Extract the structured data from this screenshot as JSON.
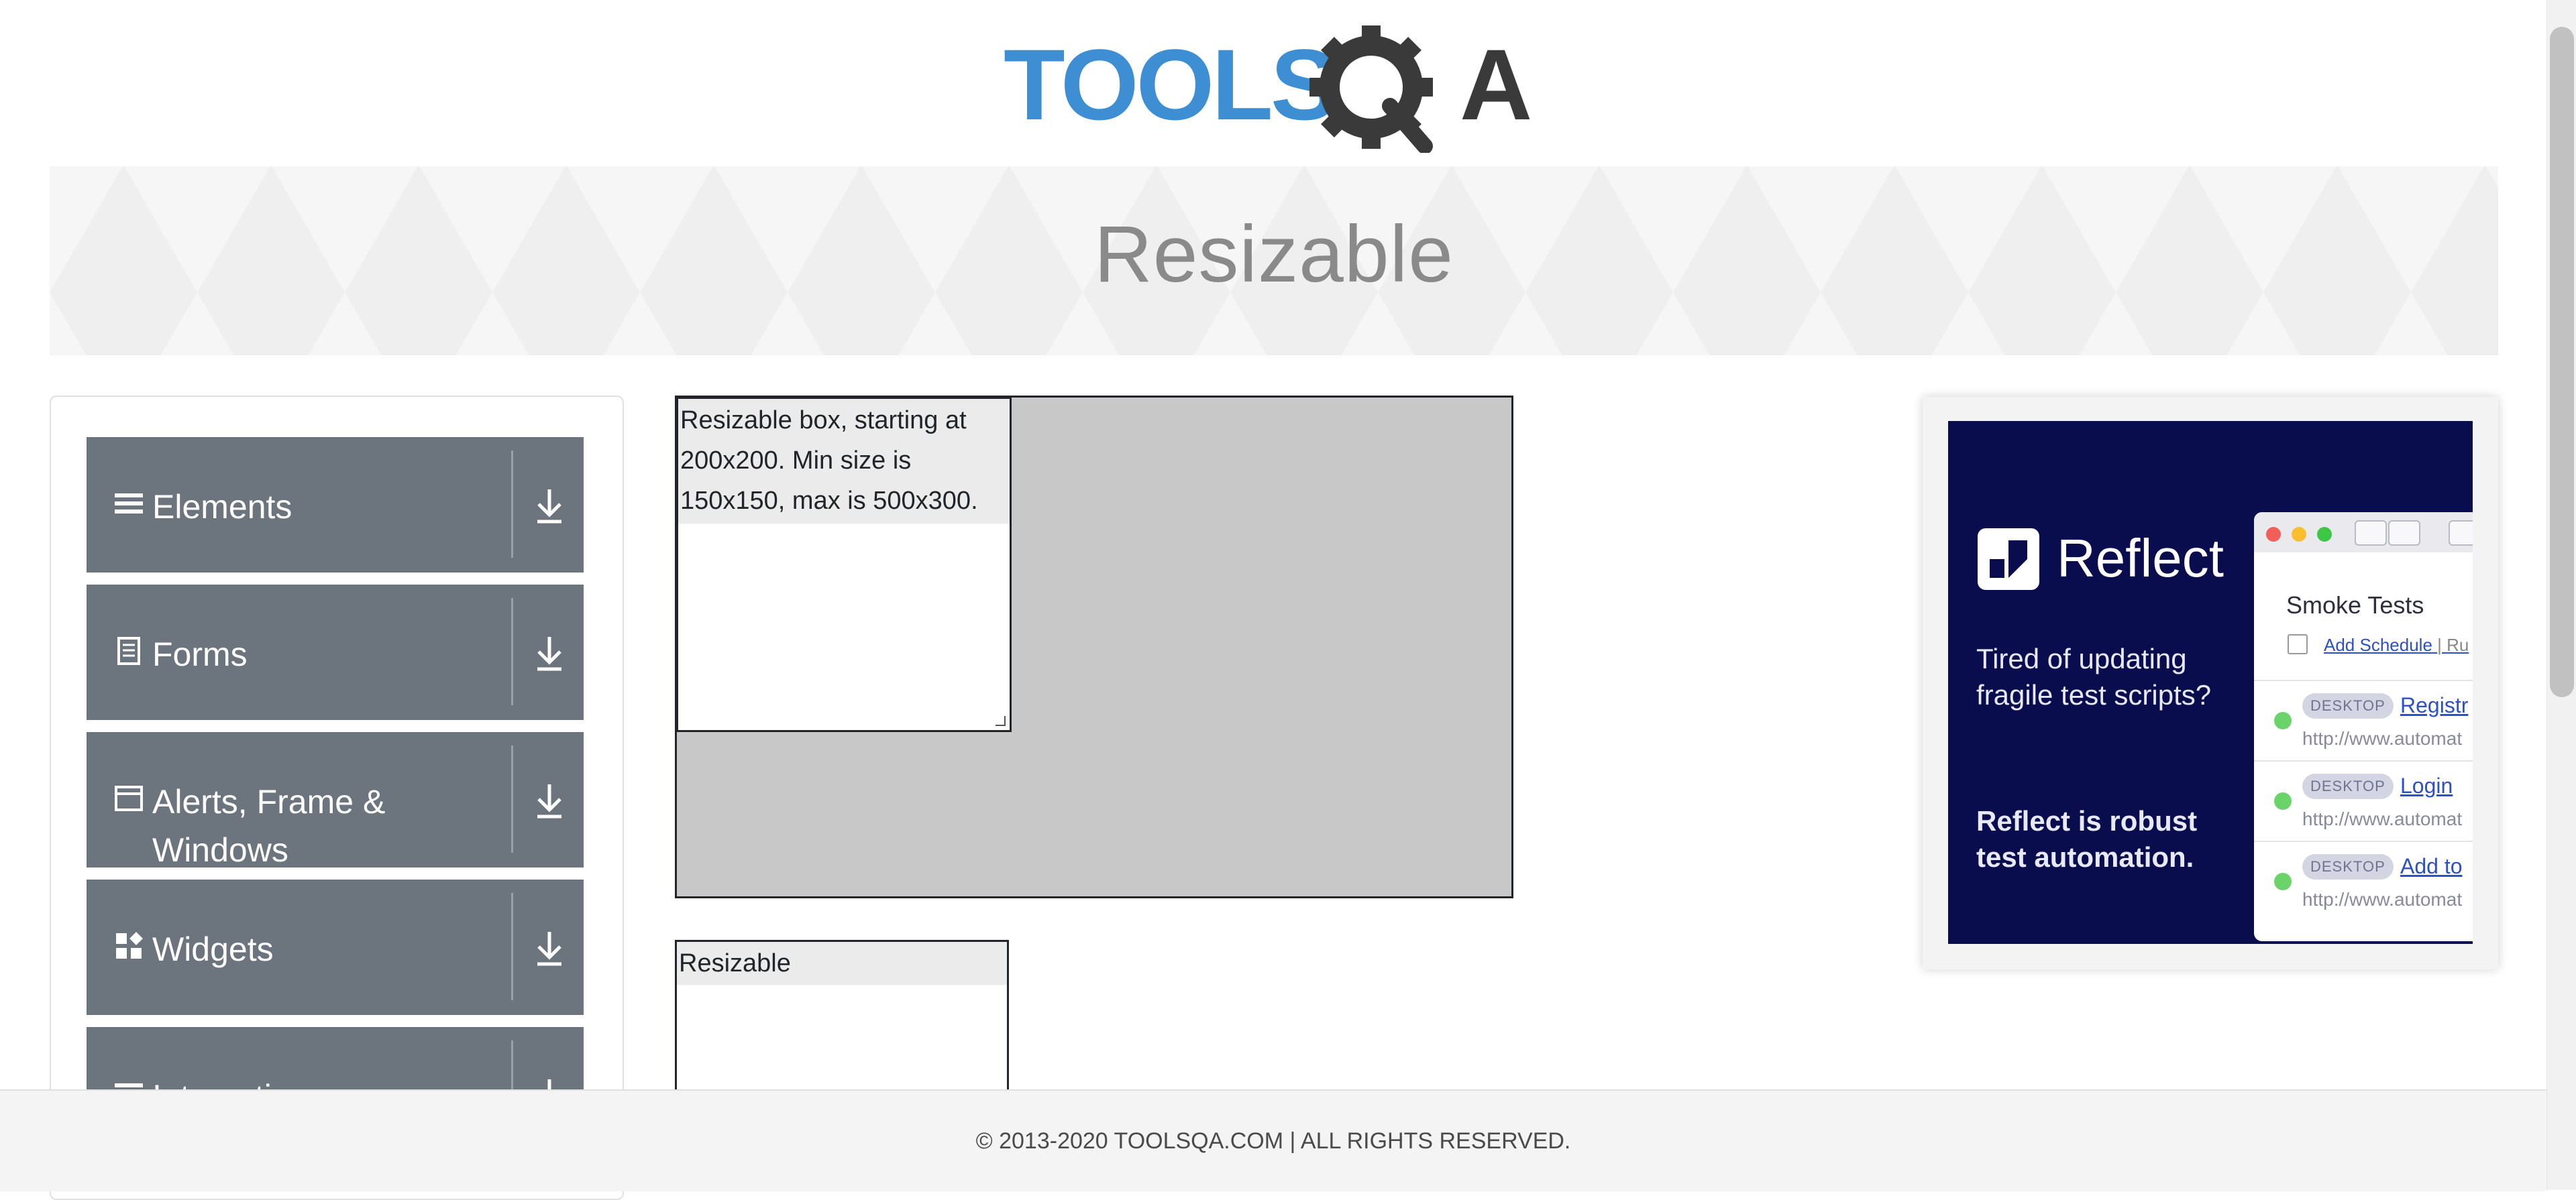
{
  "header": {
    "logo_text": "TOOLSQA"
  },
  "banner": {
    "title": "Resizable"
  },
  "sidebar": {
    "groups": [
      {
        "label": "Elements",
        "icon": "hamburger-icon"
      },
      {
        "label": "Forms",
        "icon": "document-icon"
      },
      {
        "label": "Alerts, Frame & Windows",
        "icon": "browser-window-icon"
      },
      {
        "label": "Widgets",
        "icon": "widgets-icon"
      },
      {
        "label": "Interactions",
        "icon": "hamburger-icon"
      }
    ]
  },
  "main": {
    "restricted_box_text": "Resizable box, starting at 200x200. Min size is 150x150, max is 500x300.",
    "free_box_text": "Resizable"
  },
  "ad": {
    "brand": "Reflect",
    "tagline": "Tired of updating fragile test scripts?",
    "claim": "Reflect is robust test automation.",
    "window_title": "Smoke Tests",
    "schedule_link": "Add Schedule",
    "schedule_separator": "| Ru",
    "rows": [
      {
        "badge": "DESKTOP",
        "name": "Registr",
        "url": "http://www.automat"
      },
      {
        "badge": "DESKTOP",
        "name": "Login",
        "url": "http://www.automat"
      },
      {
        "badge": "DESKTOP",
        "name": "Add to",
        "url": "http://www.automat"
      }
    ]
  },
  "footer": {
    "text": "© 2013-2020 TOOLSQA.COM | ALL RIGHTS RESERVED."
  },
  "colors": {
    "logo_blue": "#3d8ed3",
    "logo_dark": "#3a3a3a",
    "sidebar_group_bg": "#6c757d",
    "ad_bg": "#090c4d",
    "container_gray": "#c8c8c8"
  }
}
